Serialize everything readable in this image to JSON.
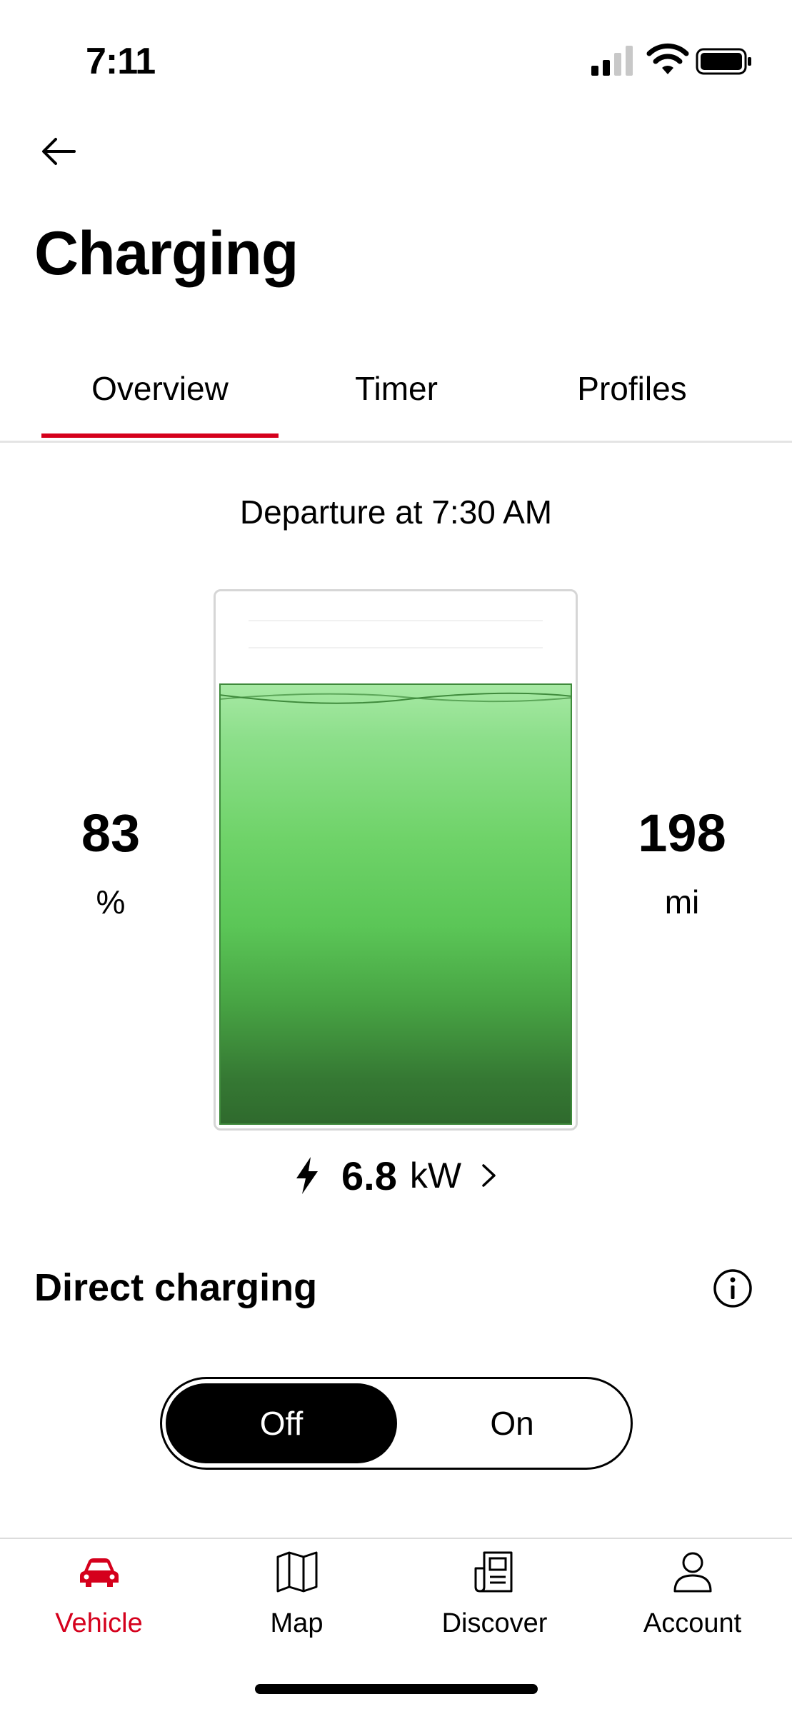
{
  "status_bar": {
    "time": "7:11"
  },
  "header": {
    "title": "Charging"
  },
  "tabs": [
    {
      "label": "Overview",
      "selected": true
    },
    {
      "label": "Timer",
      "selected": false
    },
    {
      "label": "Profiles",
      "selected": false
    }
  ],
  "overview": {
    "departure": "Departure at 7:30 AM",
    "state_of_charge": {
      "value": "83",
      "unit": "%",
      "fraction": 0.83
    },
    "range": {
      "value": "198",
      "unit": "mi"
    },
    "charging_power": {
      "value": "6.8",
      "unit": "kW"
    }
  },
  "direct_charging": {
    "label": "Direct charging",
    "options": [
      "Off",
      "On"
    ],
    "selected": "Off"
  },
  "bottom_nav": [
    {
      "label": "Vehicle",
      "icon": "car-icon",
      "active": true
    },
    {
      "label": "Map",
      "icon": "map-icon",
      "active": false
    },
    {
      "label": "Discover",
      "icon": "news-icon",
      "active": false
    },
    {
      "label": "Account",
      "icon": "person-icon",
      "active": false
    }
  ],
  "colors": {
    "accent": "#d5001c",
    "battery_fill_top": "#a7e9a4",
    "battery_fill_mid": "#5bc657",
    "battery_fill_bottom": "#2f6a2d"
  }
}
